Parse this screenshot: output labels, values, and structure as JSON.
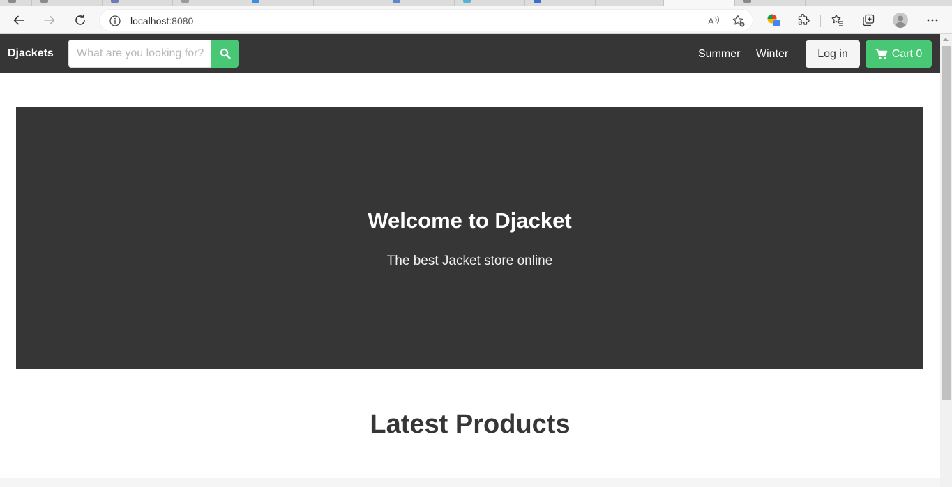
{
  "browser": {
    "address_url_host": "localhost",
    "address_url_port": ":8080"
  },
  "site": {
    "brand": "Djackets",
    "search": {
      "placeholder": "What are you looking for?"
    },
    "nav_links": [
      "Summer",
      "Winter"
    ],
    "login_label": "Log in",
    "cart_label": "Cart 0"
  },
  "hero": {
    "title": "Welcome to Djacket",
    "subtitle": "The best Jacket store online"
  },
  "section": {
    "title": "Latest Products"
  },
  "colors": {
    "navbar": "#363636",
    "primary_green": "#48c774",
    "hero_bg": "#363636"
  }
}
